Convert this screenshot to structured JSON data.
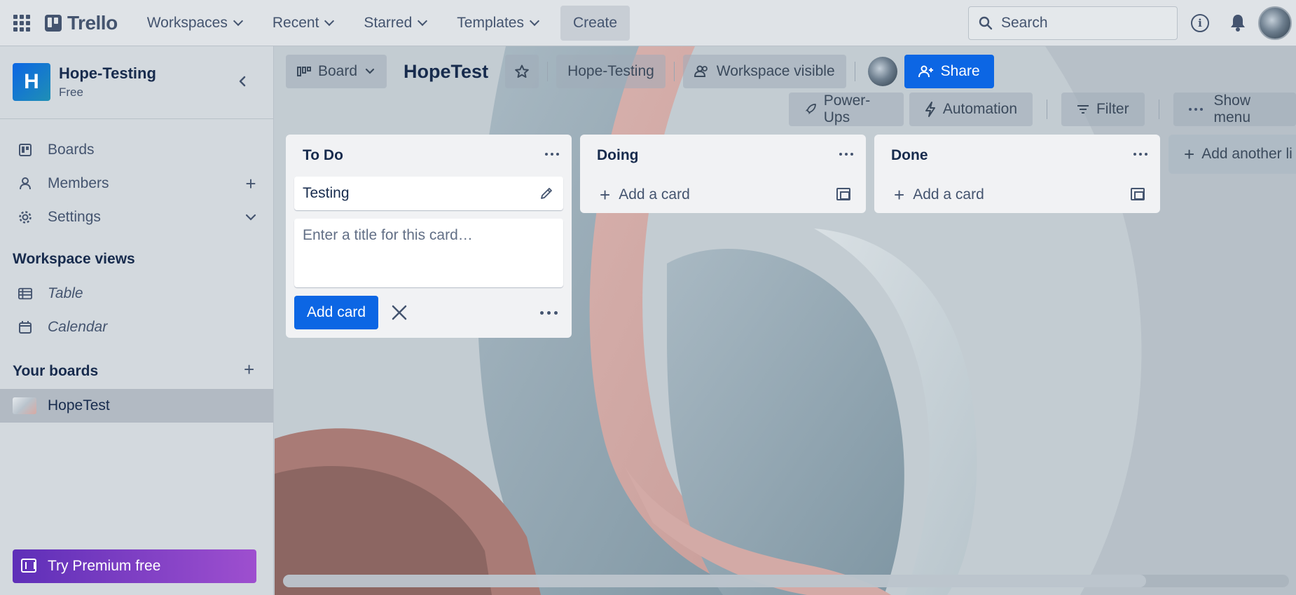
{
  "topbar": {
    "logo": "Trello",
    "nav": [
      "Workspaces",
      "Recent",
      "Starred",
      "Templates"
    ],
    "create_label": "Create",
    "search_placeholder": "Search"
  },
  "sidebar": {
    "workspace_initial": "H",
    "workspace_name": "Hope-Testing",
    "workspace_plan": "Free",
    "items": [
      {
        "label": "Boards"
      },
      {
        "label": "Members"
      },
      {
        "label": "Settings"
      }
    ],
    "views_heading": "Workspace views",
    "views": [
      {
        "label": "Table"
      },
      {
        "label": "Calendar"
      }
    ],
    "boards_heading": "Your boards",
    "boards": [
      {
        "label": "HopeTest"
      }
    ],
    "premium_label": "Try Premium free"
  },
  "board": {
    "view_label": "Board",
    "title": "HopeTest",
    "workspace_chip": "Hope-Testing",
    "visibility_chip": "Workspace visible",
    "share_label": "Share",
    "actions": [
      "Power-Ups",
      "Automation",
      "Filter",
      "Show menu"
    ],
    "add_list_label": "Add another li"
  },
  "lists": [
    {
      "title": "To Do",
      "cards": [
        "Testing"
      ],
      "composer_placeholder": "Enter a title for this card…",
      "add_card_button": "Add card"
    },
    {
      "title": "Doing",
      "add_row": "Add a card"
    },
    {
      "title": "Done",
      "add_row": "Add a card"
    }
  ],
  "colors": {
    "accent": "#0c66e4",
    "premium_start": "#5e2fb8",
    "premium_end": "#9e4fcf"
  }
}
